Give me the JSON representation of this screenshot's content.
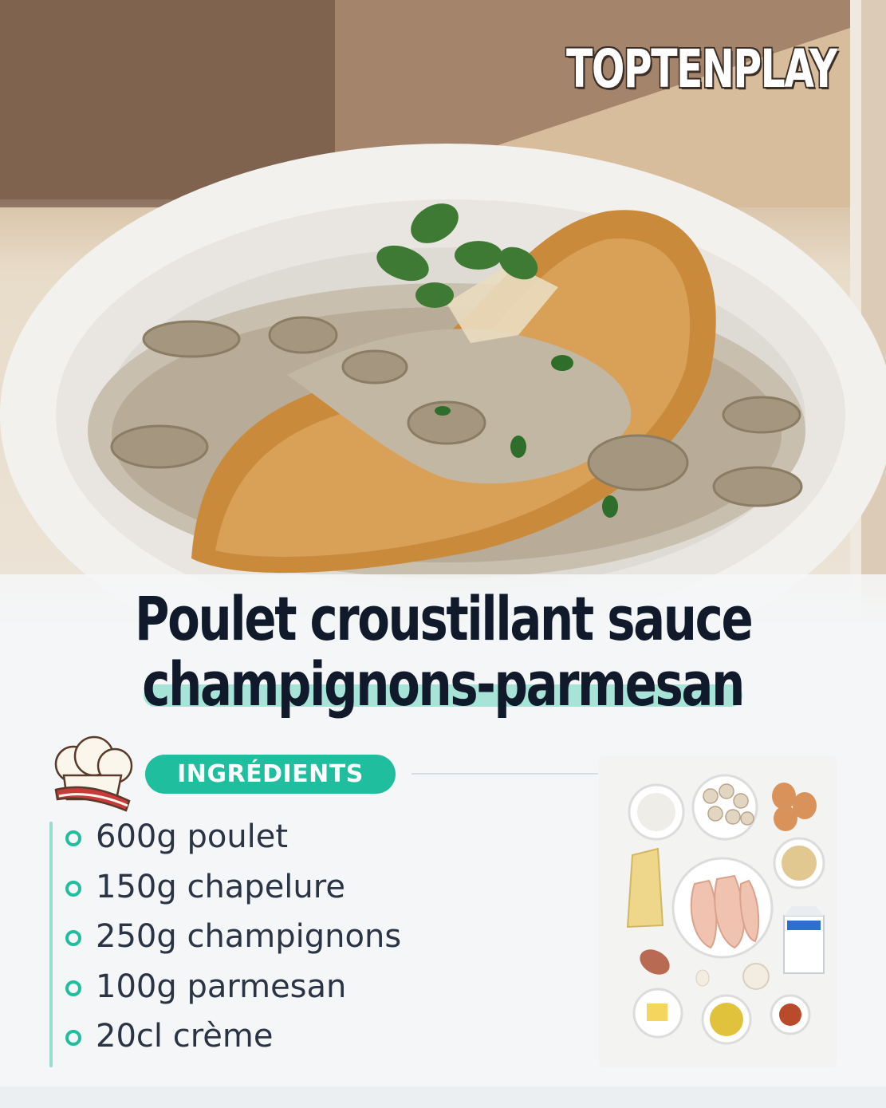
{
  "brand": {
    "name": "TOPTENPLAY"
  },
  "hero": {
    "image": "photo-crispy-chicken-mushroom-parmesan-sauce"
  },
  "recipe": {
    "title_line1": "Poulet croustillant sauce",
    "title_line2": "champignons-parmesan"
  },
  "ingredients": {
    "heading": "INGRÉDIENTS",
    "icon": "chef-hat-icon",
    "items": [
      {
        "label": "600g poulet"
      },
      {
        "label": "150g chapelure"
      },
      {
        "label": "250g champignons"
      },
      {
        "label": "100g parmesan"
      },
      {
        "label": "20cl crème"
      }
    ],
    "photo": "photo-ingredients-flatlay"
  },
  "colors": {
    "accent": "#1fbe9e",
    "accent_light": "#a8e3d8",
    "title_text": "#101a2b",
    "body_text": "#2a3444",
    "background": "#f4f6f7"
  }
}
